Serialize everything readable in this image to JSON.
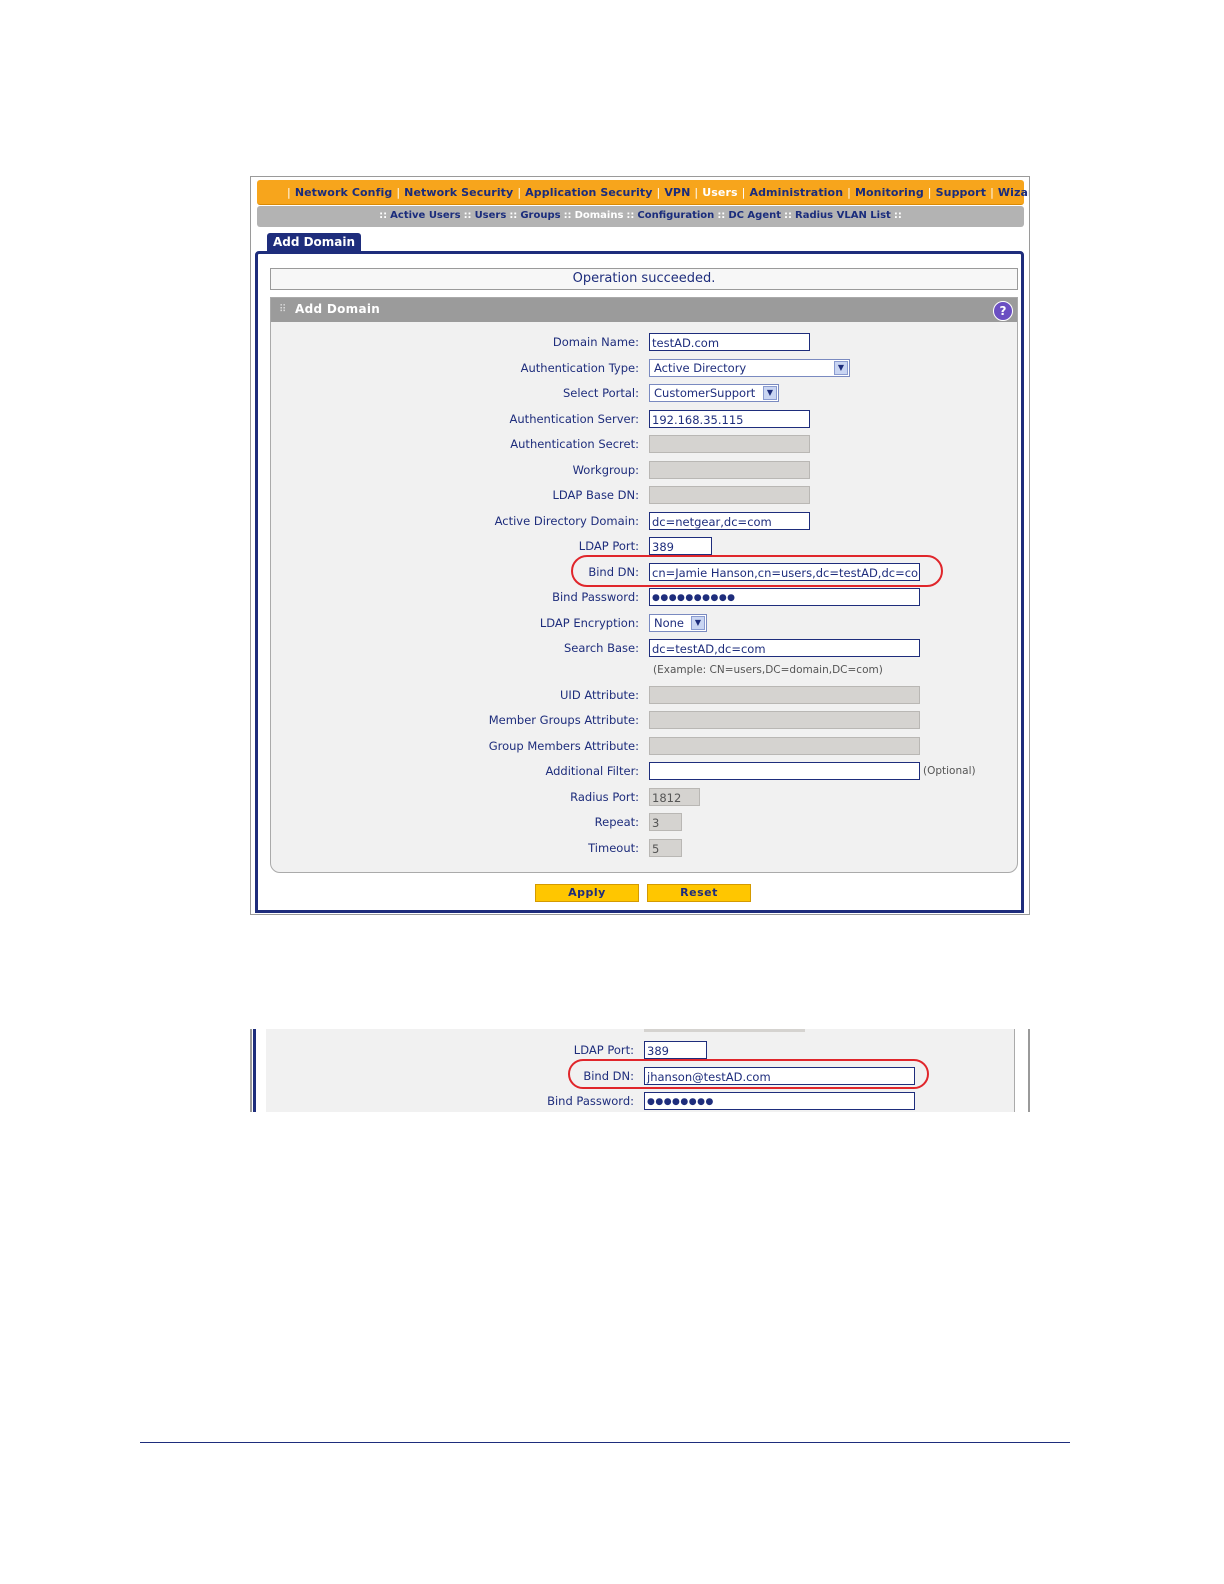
{
  "nav": {
    "top": [
      "Network Config",
      "Network Security",
      "Application Security",
      "VPN",
      "Users",
      "Administration",
      "Monitoring",
      "Support",
      "Wizards"
    ],
    "sub": [
      "Active Users",
      "Users",
      "Groups",
      "Domains",
      "Configuration",
      "DC Agent",
      "Radius VLAN List"
    ]
  },
  "tab": {
    "label": "Add Domain"
  },
  "status": {
    "message": "Operation succeeded."
  },
  "panel": {
    "title": "Add Domain",
    "help_icon": "?"
  },
  "form": {
    "domain_name": {
      "label": "Domain Name:",
      "value": "testAD.com"
    },
    "auth_type": {
      "label": "Authentication Type:",
      "value": "Active Directory"
    },
    "portal": {
      "label": "Select Portal:",
      "value": "CustomerSupport"
    },
    "auth_server": {
      "label": "Authentication Server:",
      "value": "192.168.35.115"
    },
    "auth_secret": {
      "label": "Authentication Secret:",
      "value": ""
    },
    "workgroup": {
      "label": "Workgroup:",
      "value": ""
    },
    "ldap_base_dn": {
      "label": "LDAP Base DN:",
      "value": ""
    },
    "ad_domain": {
      "label": "Active Directory Domain:",
      "value": "dc=netgear,dc=com"
    },
    "ldap_port": {
      "label": "LDAP Port:",
      "value": "389"
    },
    "bind_dn": {
      "label": "Bind DN:",
      "value": "cn=Jamie Hanson,cn=users,dc=testAD,dc=com"
    },
    "bind_password": {
      "label": "Bind Password:",
      "value": "●●●●●●●●●●"
    },
    "ldap_encryption": {
      "label": "LDAP Encryption:",
      "value": "None"
    },
    "search_base": {
      "label": "Search Base:",
      "value": "dc=testAD,dc=com",
      "example": "(Example: CN=users,DC=domain,DC=com)"
    },
    "uid_attr": {
      "label": "UID Attribute:",
      "value": ""
    },
    "member_groups_attr": {
      "label": "Member Groups Attribute:",
      "value": ""
    },
    "group_members_attr": {
      "label": "Group Members Attribute:",
      "value": ""
    },
    "additional_filter": {
      "label": "Additional Filter:",
      "value": "",
      "hint": "(Optional)"
    },
    "radius_port": {
      "label": "Radius Port:",
      "value": "1812"
    },
    "repeat": {
      "label": "Repeat:",
      "value": "3"
    },
    "timeout": {
      "label": "Timeout:",
      "value": "5"
    }
  },
  "buttons": {
    "apply": "Apply",
    "reset": "Reset"
  },
  "snippet": {
    "ldap_port": {
      "label": "LDAP Port:",
      "value": "389"
    },
    "bind_dn": {
      "label": "Bind DN:",
      "value": "jhanson@testAD.com"
    },
    "bind_password": {
      "label": "Bind Password:",
      "value": "●●●●●●●●"
    }
  },
  "colors": {
    "nav_orange": "#f7a51c",
    "navy": "#1e2d7c",
    "highlight_red": "#e0262b",
    "button_yellow": "#ffc600"
  }
}
